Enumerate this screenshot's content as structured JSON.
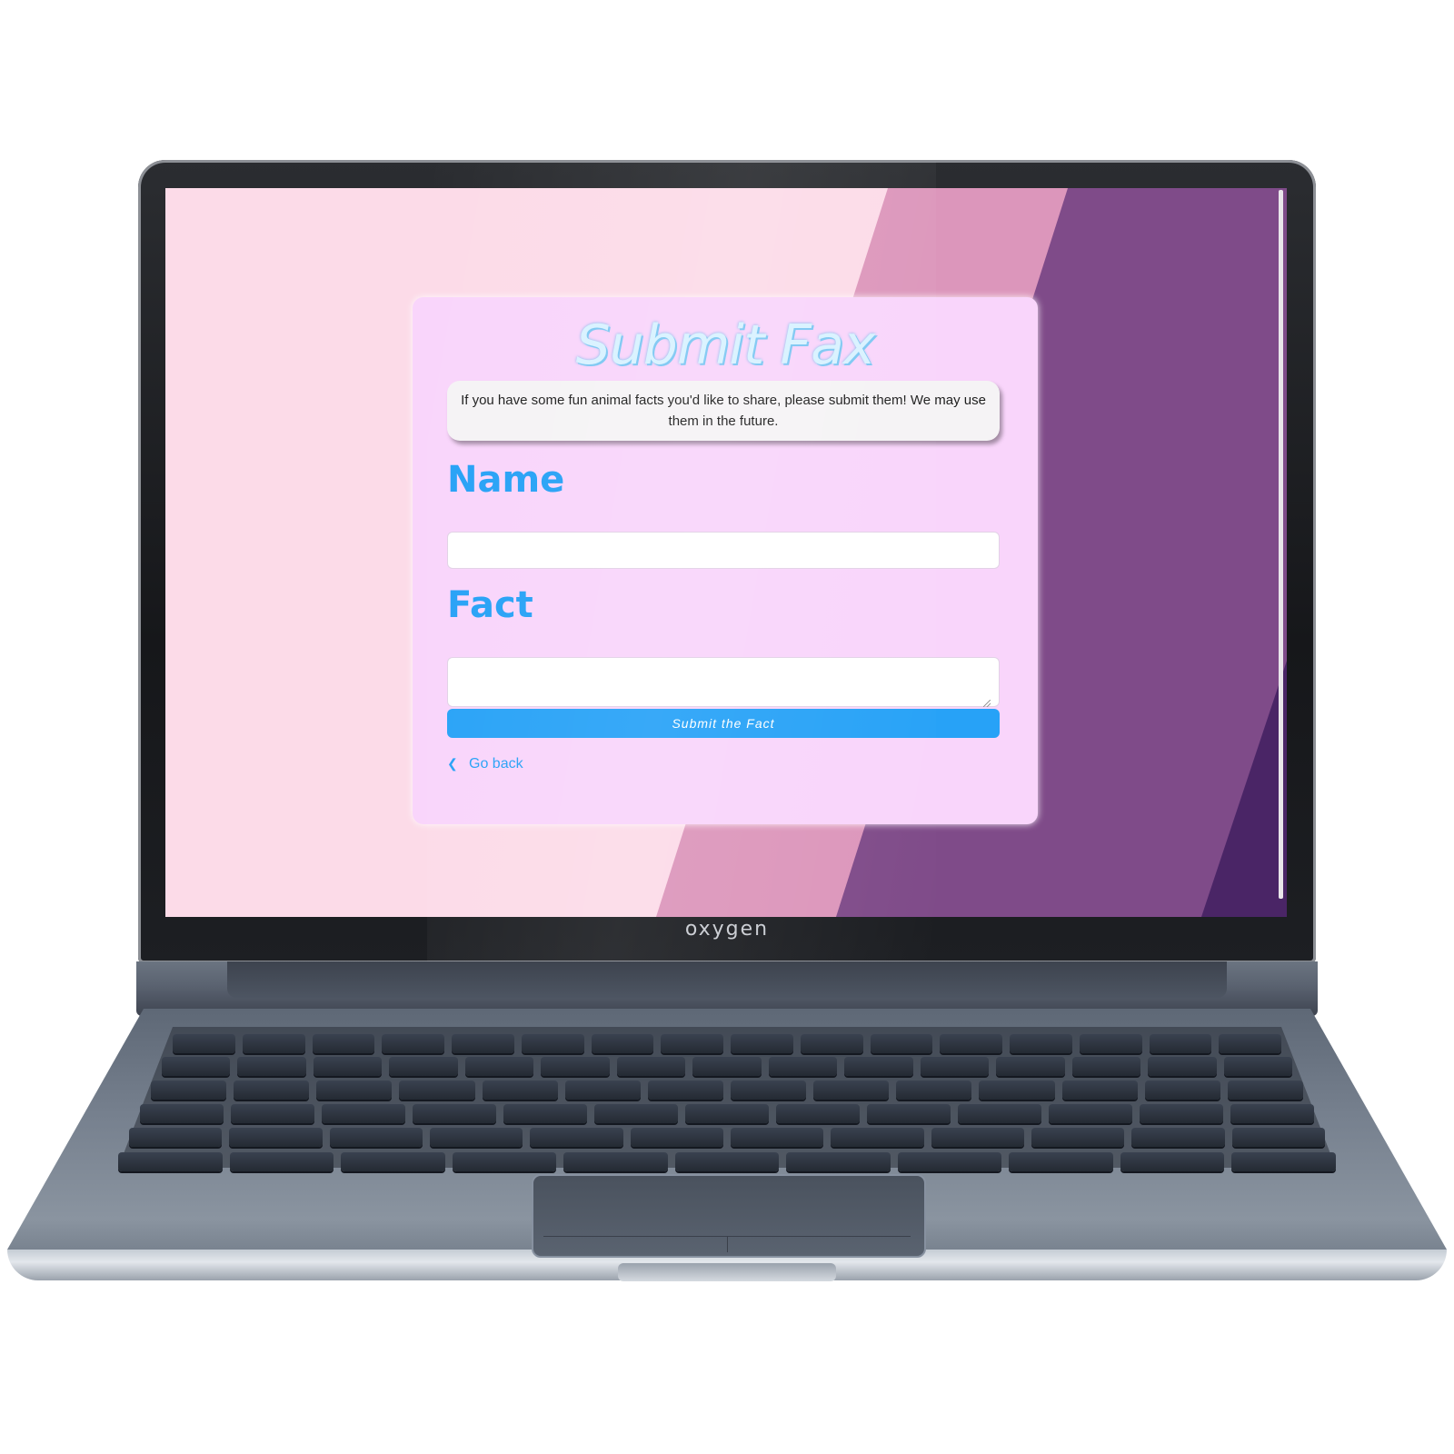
{
  "device": {
    "brand": "oxygen"
  },
  "page": {
    "title": "Submit Fax",
    "intro": "If you have some fun animal facts you'd like to share, please submit them! We may use them in the future.",
    "form": {
      "name_label": "Name",
      "name_value": "",
      "fact_label": "Fact",
      "fact_value": "",
      "submit_label": "Submit the Fact"
    },
    "back_link": {
      "label": "Go back",
      "icon": "chevron-left-icon"
    }
  },
  "colors": {
    "background": "#fcdbe8",
    "band_pink": "#dc96bb",
    "band_purple": "#7f4b89",
    "band_dark": "#4a2566",
    "card": "#f9d5fb",
    "accent": "#26a1f6"
  }
}
